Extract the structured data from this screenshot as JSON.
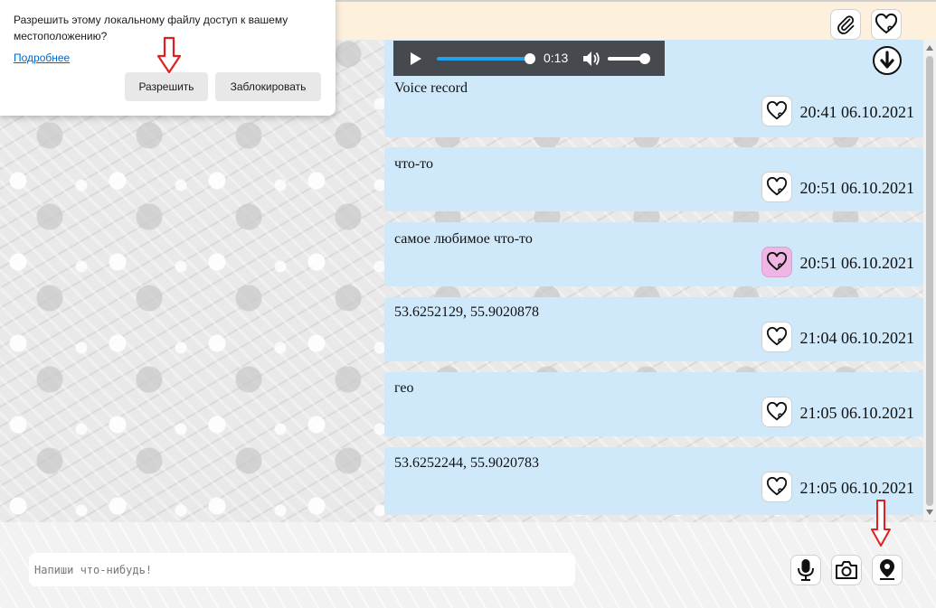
{
  "popup": {
    "message": "Разрешить этому локальному файлу доступ к вашему местоположению?",
    "more_link": "Подробнее",
    "allow_label": "Разрешить",
    "block_label": "Заблокировать"
  },
  "header": {
    "attach_icon": "paperclip-icon",
    "favorites_icon": "heart-icon"
  },
  "audio": {
    "time": "0:13",
    "progress": 1.0,
    "volume": 0.85
  },
  "messages": [
    {
      "text": "Voice record",
      "time": "20:41 06.10.2021",
      "liked": false
    },
    {
      "text": "что-то",
      "time": "20:51 06.10.2021",
      "liked": false
    },
    {
      "text": "самое любимое что-то",
      "time": "20:51 06.10.2021",
      "liked": true
    },
    {
      "text": "53.6252129, 55.9020878",
      "time": "21:04 06.10.2021",
      "liked": false
    },
    {
      "text": "гео",
      "time": "21:05 06.10.2021",
      "liked": false
    },
    {
      "text": "53.6252244, 55.9020783",
      "time": "21:05 06.10.2021",
      "liked": false
    }
  ],
  "composer": {
    "placeholder": "Напиши что-нибудь!",
    "mic_icon": "microphone-icon",
    "camera_icon": "camera-icon",
    "location_icon": "map-pin-icon"
  },
  "colors": {
    "message_bg": "#cfe9fb",
    "liked_bg": "#efb5e4",
    "header_bg": "#fdf0dc",
    "annotation_arrow": "#e02020"
  }
}
